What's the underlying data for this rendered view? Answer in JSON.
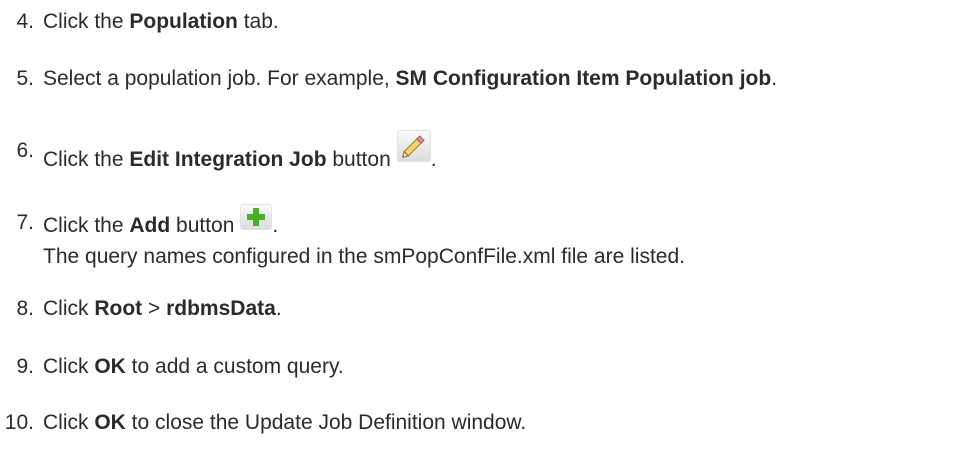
{
  "steps": [
    {
      "num": "4.",
      "a": "Click the ",
      "b": "Population",
      "c": " tab."
    },
    {
      "num": "5.",
      "a": "Select a population job. For example, ",
      "b": "SM Configuration Item Population job",
      "c": "."
    },
    {
      "num": "6.",
      "a": "Click the ",
      "b": "Edit Integration Job",
      "c": " button",
      "d": "."
    },
    {
      "num": "7.",
      "a": "Click the ",
      "b": "Add",
      "c": " button",
      "d": "."
    },
    {
      "num": "8.",
      "a": "Click ",
      "b": "Root",
      "c": " > ",
      "d": "rdbmsData",
      "e": "."
    },
    {
      "num": "9.",
      "a": "Click ",
      "b": "OK",
      "c": " to add a custom query."
    },
    {
      "num": "10.",
      "a": "Click ",
      "b": "OK",
      "c": " to close the Update Job Definition window."
    }
  ],
  "note": "The query names configured in the smPopConfFile.xml file are listed.",
  "icons": {
    "edit": "pencil-icon",
    "add": "plus-icon",
    "plus_color": "#4caf2a"
  }
}
